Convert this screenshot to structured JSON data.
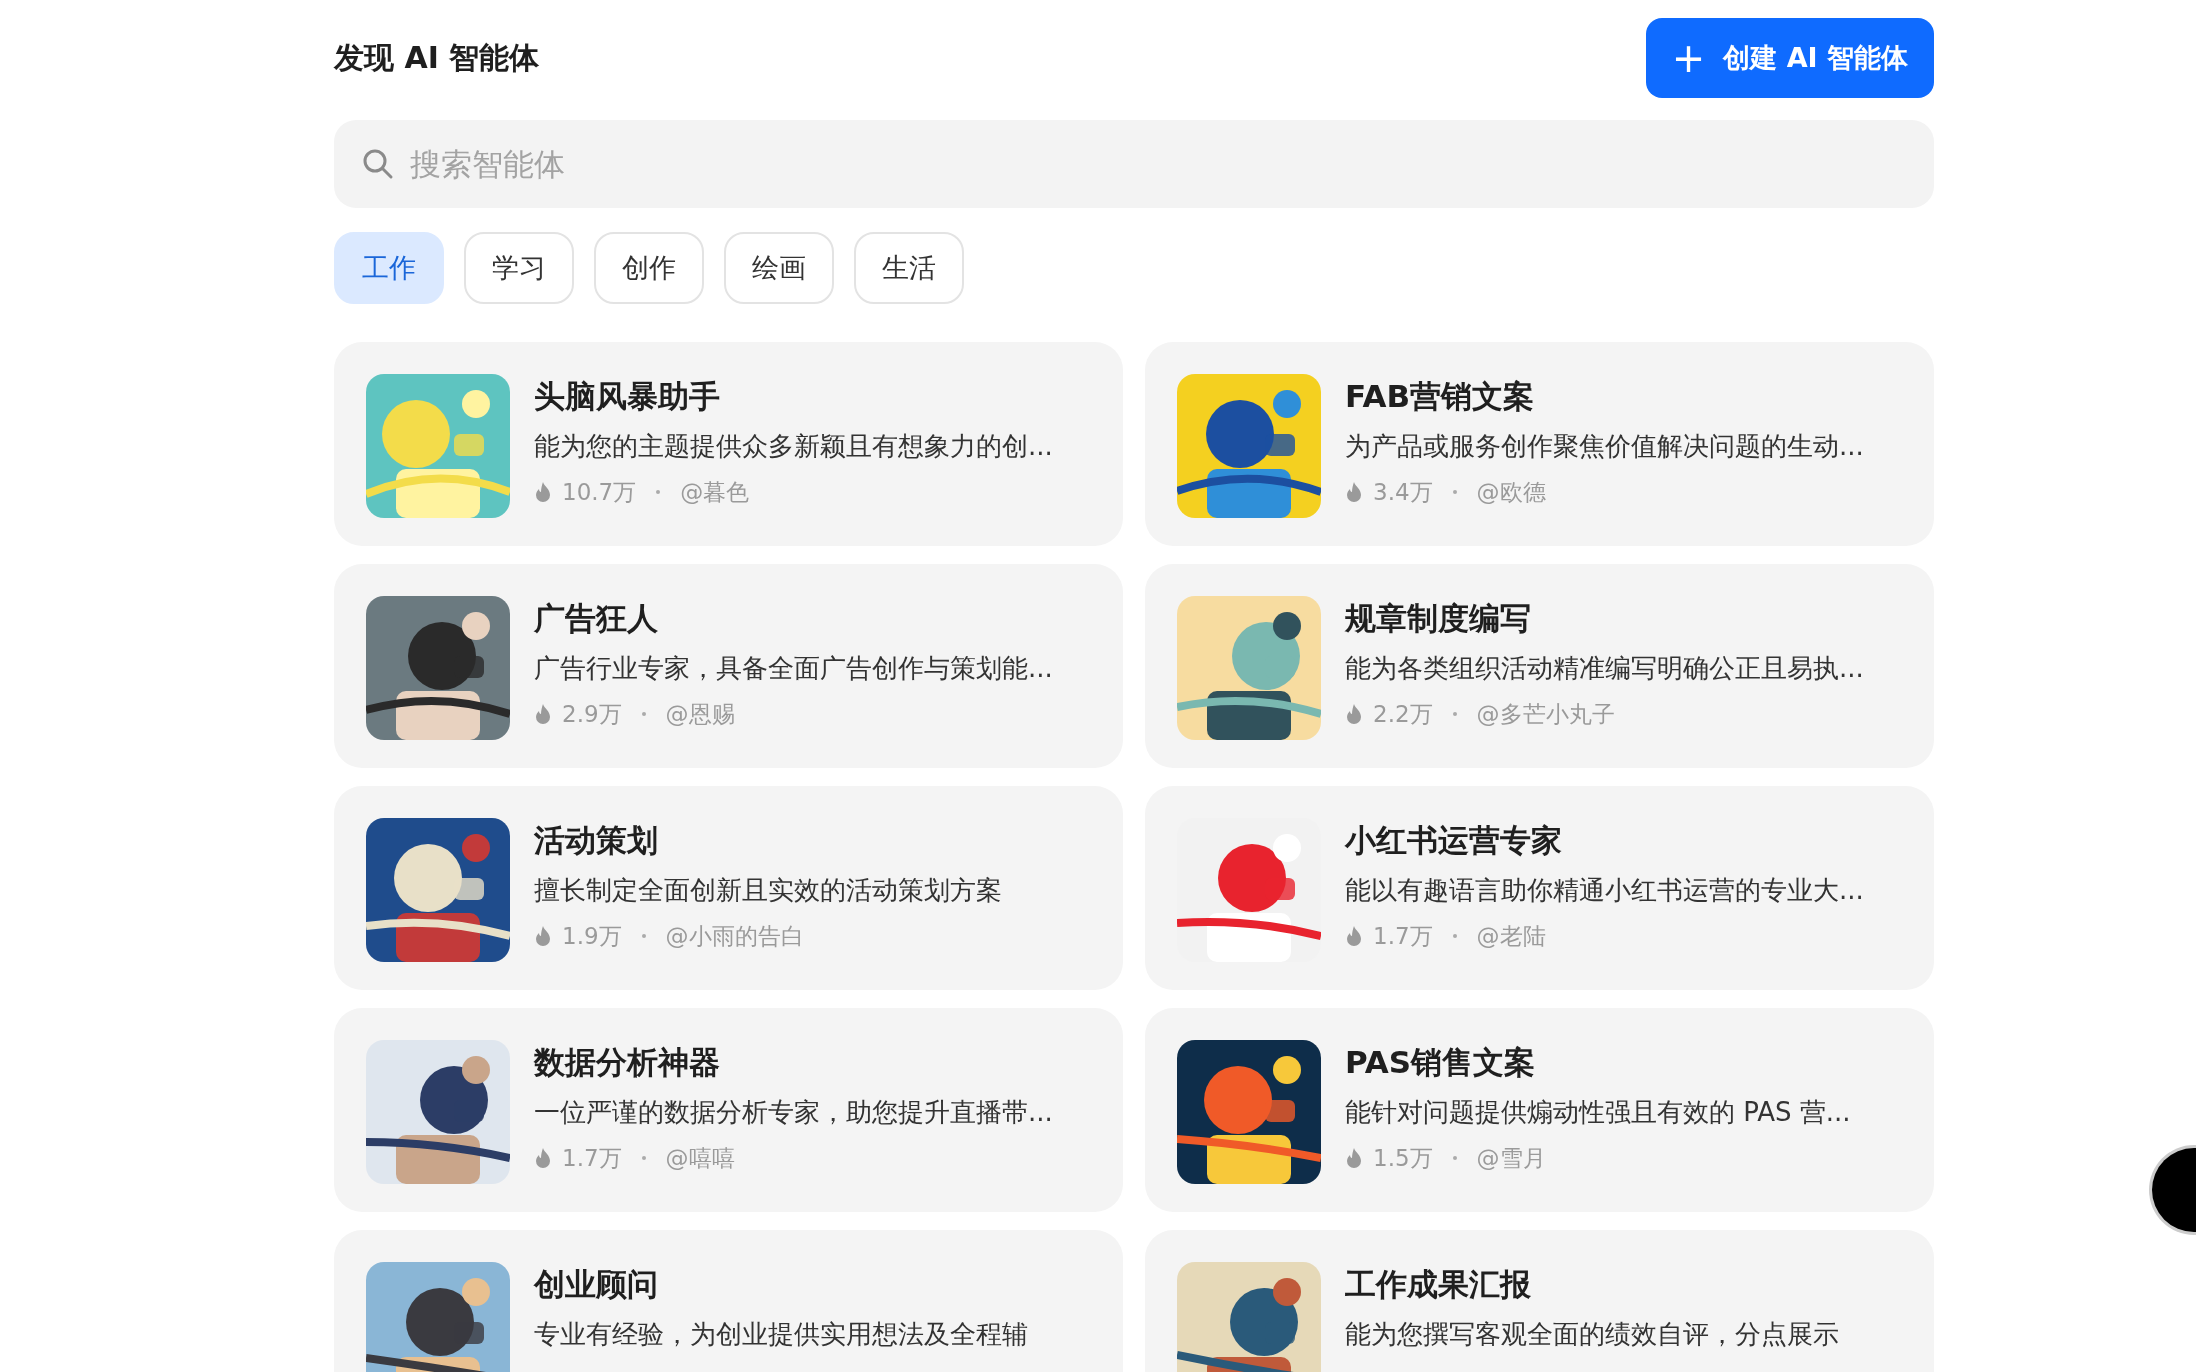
{
  "header": {
    "title": "发现 AI 智能体",
    "create_button": {
      "icon": "+",
      "label": "创建 AI 智能体"
    }
  },
  "search": {
    "placeholder": "搜索智能体"
  },
  "tabs": [
    {
      "label": "工作",
      "selected": true
    },
    {
      "label": "学习",
      "selected": false
    },
    {
      "label": "创作",
      "selected": false
    },
    {
      "label": "绘画",
      "selected": false
    },
    {
      "label": "生活",
      "selected": false
    }
  ],
  "agents": [
    {
      "title": "头脑风暴助手",
      "description": "能为您的主题提供众多新颖且有想象力的创...",
      "count": "10.7万",
      "author": "@暮色"
    },
    {
      "title": "FAB营销文案",
      "description": "为产品或服务创作聚焦价值解决问题的生动...",
      "count": "3.4万",
      "author": "@欧德"
    },
    {
      "title": "广告狂人",
      "description": "广告行业专家，具备全面广告创作与策划能...",
      "count": "2.9万",
      "author": "@恩赐"
    },
    {
      "title": "规章制度编写",
      "description": "能为各类组织活动精准编写明确公正且易执...",
      "count": "2.2万",
      "author": "@多芒小丸子"
    },
    {
      "title": "活动策划",
      "description": "擅长制定全面创新且实效的活动策划方案",
      "count": "1.9万",
      "author": "@小雨的告白"
    },
    {
      "title": "小红书运营专家",
      "description": "能以有趣语言助你精通小红书运营的专业大...",
      "count": "1.7万",
      "author": "@老陆"
    },
    {
      "title": "数据分析神器",
      "description": "一位严谨的数据分析专家，助您提升直播带...",
      "count": "1.7万",
      "author": "@嘻嘻"
    },
    {
      "title": "PAS销售文案",
      "description": "能针对问题提供煽动性强且有效的 PAS 营...",
      "count": "1.5万",
      "author": "@雪月"
    },
    {
      "title": "创业顾问",
      "description": "专业有经验，为创业提供实用想法及全程辅"
    },
    {
      "title": "工作成果汇报",
      "description": "能为您撰写客观全面的绩效自评，分点展示"
    }
  ]
}
